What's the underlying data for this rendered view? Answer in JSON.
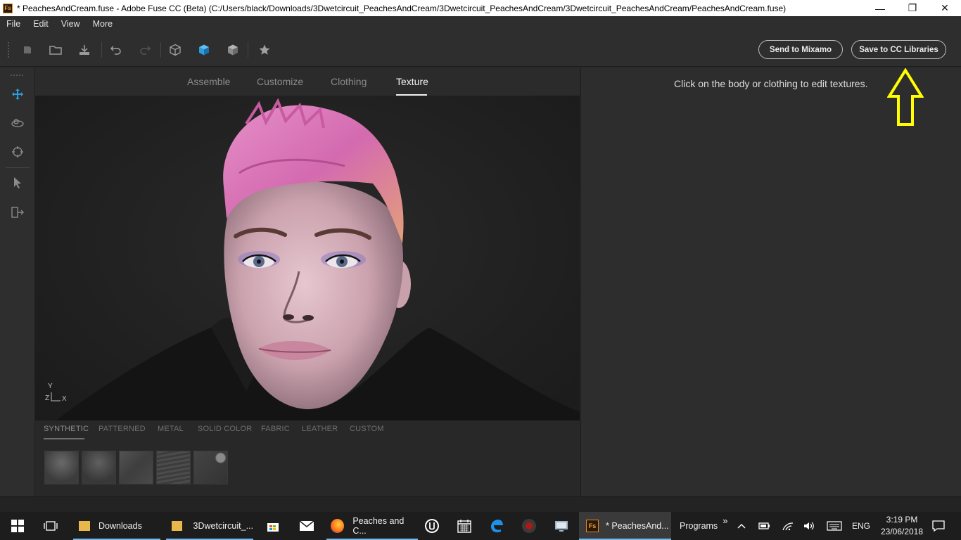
{
  "window": {
    "app_icon": "Fs",
    "title": "* PeachesAndCream.fuse - Adobe Fuse CC (Beta) (C:/Users/black/Downloads/3Dwetcircuit_PeachesAndCream/3Dwetcircuit_PeachesAndCream/3Dwetcircuit_PeachesAndCream/PeachesAndCream.fuse)",
    "minimize": "—",
    "restore": "❐",
    "close": "✕"
  },
  "menu": [
    "File",
    "Edit",
    "View",
    "More"
  ],
  "toolbar": {
    "send_to_mixamo": "Send to Mixamo",
    "save_to_cc": "Save to CC Libraries"
  },
  "tabs": [
    "Assemble",
    "Customize",
    "Clothing",
    "Texture"
  ],
  "active_tab": "Texture",
  "viewport": {
    "axis_y": "Y",
    "axis_z": "Z",
    "axis_x": "X"
  },
  "material_categories": [
    "SYNTHETIC",
    "PATTERNED",
    "METAL",
    "SOLID COLOR",
    "FABRIC",
    "LEATHER",
    "CUSTOM"
  ],
  "active_category": "SYNTHETIC",
  "right_panel": {
    "hint": "Click on the body or clothing to edit textures."
  },
  "taskbar": {
    "items": [
      {
        "label": "Downloads",
        "icon": "folder-icon"
      },
      {
        "label": "3Dwetcircuit_...",
        "icon": "folder-icon"
      },
      {
        "label": "Peaches and C...",
        "icon": "firefox-icon"
      },
      {
        "label": "* PeachesAnd...",
        "icon": "fuse-icon"
      }
    ],
    "programs": "Programs",
    "chevron": "»",
    "lang": "ENG",
    "time": "3:19 PM",
    "date": "23/06/2018"
  },
  "colors": {
    "accent_blue": "#2d9cdb",
    "annotation_yellow": "#ffff00",
    "panel_bg": "#2d2d2d"
  }
}
